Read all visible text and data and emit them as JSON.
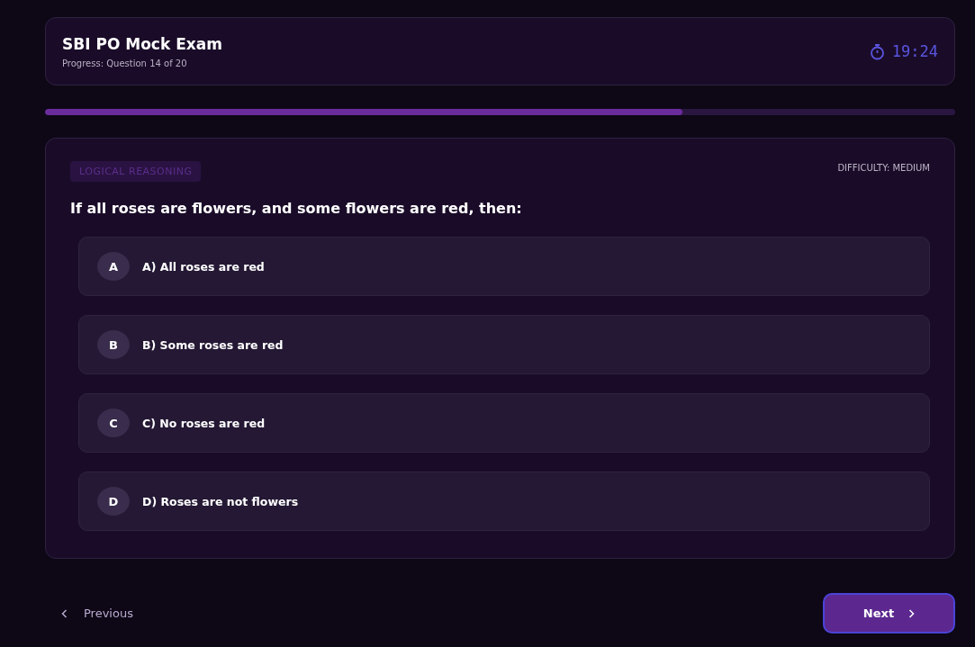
{
  "header": {
    "title": "SBI PO Mock Exam",
    "progress_text": "Progress: Question 14 of 20",
    "timer": "19:24"
  },
  "progress": {
    "level": 0.7
  },
  "question": {
    "category": "LOGICAL REASONING",
    "difficulty": "DIFFICULTY: MEDIUM",
    "text": "If all roses are flowers, and some flowers are red, then:",
    "options": [
      {
        "letter": "A",
        "text": "A) All roses are red",
        "selected": false
      },
      {
        "letter": "B",
        "text": "B) Some roses are red",
        "selected": false
      },
      {
        "letter": "C",
        "text": "C) No roses are red",
        "selected": false
      },
      {
        "letter": "D",
        "text": "D) Roses are not flowers",
        "selected": false
      }
    ]
  },
  "nav": {
    "previous": "Previous",
    "next": "Next"
  }
}
